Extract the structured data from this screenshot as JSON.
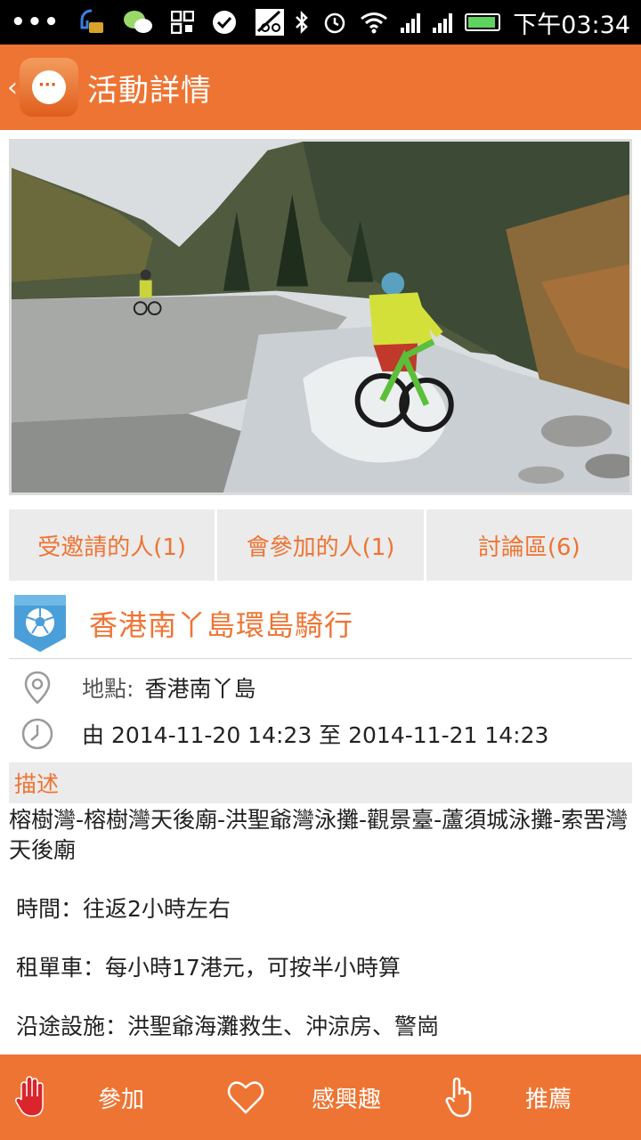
{
  "status_bar": {
    "time": "下午03:34",
    "left_icons": [
      "overflow-dots-icon",
      "chat-bubble-icon",
      "wechat-icon",
      "qr-app-icon",
      "checkmark-icon",
      "bike-app-icon"
    ],
    "right_icons": [
      "bluetooth-icon",
      "alarm-icon",
      "wifi-icon",
      "signal-icon",
      "signal-icon",
      "battery-icon"
    ]
  },
  "app_bar": {
    "back_glyph": "‹",
    "title": "活動詳情",
    "logo_icon": "app-logo-chat-icon"
  },
  "hero_image": {
    "description_icon": "photo-mountain-bikers-crossing-river"
  },
  "tabs": [
    {
      "label": "受邀請的人(1)"
    },
    {
      "label": "會參加的人(1)"
    },
    {
      "label": "討論區(6)"
    }
  ],
  "event": {
    "title": "香港南丫島環島騎行",
    "category_icon": "soccer-ball-badge-icon",
    "location_label": "地點:",
    "location_value": "香港南丫島",
    "time_text": "由 2014-11-20 14:23 至 2014-11-21 14:23"
  },
  "description": {
    "header": "描述",
    "paragraphs": [
      "榕樹灣-榕樹灣天後廟-洪聖爺灣泳攤-觀景臺-蘆須城泳攤-索罟灣天後廟",
      "時間：往返2小時左右",
      "租單車：每小時17港元，可按半小時算",
      "沿途設施：洪聖爺海灘救生、沖涼房、警崗"
    ]
  },
  "bottom_bar": {
    "join_label": "參加",
    "interested_label": "感興趣",
    "recommend_label": "推薦"
  },
  "colors": {
    "brand_orange": "#ee7433",
    "tab_bg": "#ebebeb",
    "badge_blue": "#4a9fd8"
  }
}
